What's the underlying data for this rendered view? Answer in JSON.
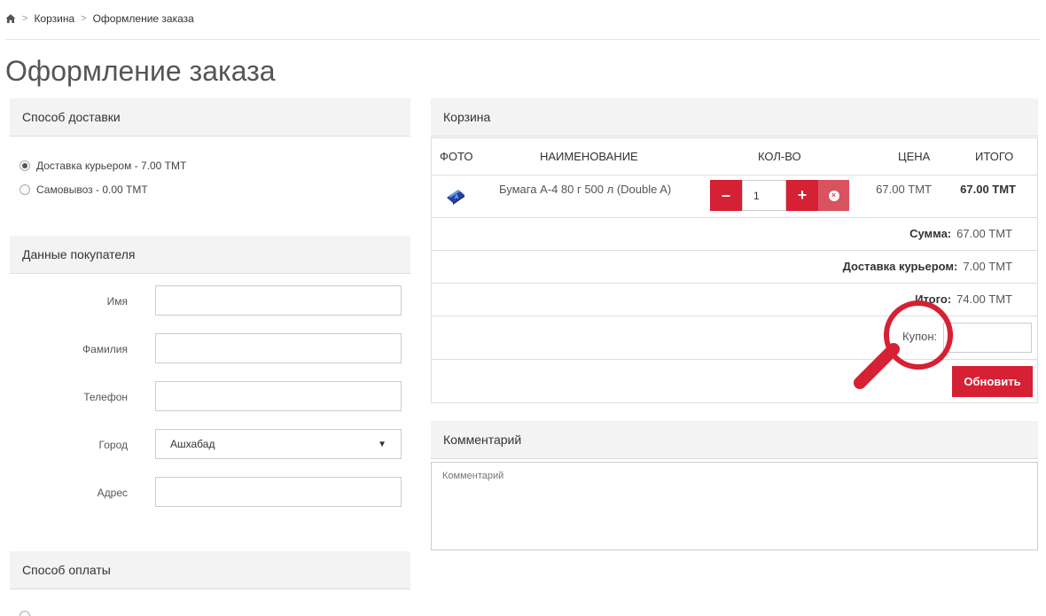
{
  "breadcrumb": {
    "items": [
      "Корзина",
      "Оформление заказа"
    ]
  },
  "page_title": "Оформление заказа",
  "delivery": {
    "heading": "Способ доставки",
    "options": [
      {
        "label": "Доставка курьером - 7.00 ТМТ",
        "checked": true
      },
      {
        "label": "Самовывоз - 0.00 ТМТ",
        "checked": false
      }
    ]
  },
  "buyer": {
    "heading": "Данные покупателя",
    "fields": {
      "first_name": {
        "label": "Имя",
        "value": ""
      },
      "last_name": {
        "label": "Фамилия",
        "value": ""
      },
      "phone": {
        "label": "Телефон",
        "value": ""
      },
      "city": {
        "label": "Город",
        "value": "Ашхабад"
      },
      "address": {
        "label": "Адрес",
        "value": ""
      }
    }
  },
  "payment": {
    "heading": "Способ оплаты"
  },
  "cart": {
    "heading": "Корзина",
    "columns": {
      "photo": "ФОТО",
      "name": "НАИМЕНОВАНИЕ",
      "qty": "КОЛ-ВО",
      "price": "ЦЕНА",
      "total": "ИТОГО"
    },
    "items": [
      {
        "name": "Бумага А-4 80 г 500 л (Double A)",
        "qty": "1",
        "price": "67.00 ТМТ",
        "total": "67.00 ТМТ"
      }
    ],
    "summary": {
      "sum_label": "Сумма:",
      "sum_value": "67.00 ТМТ",
      "delivery_label": "Доставка курьером:",
      "delivery_value": "7.00 ТМТ",
      "total_label": "Итого:",
      "total_value": "74.00 ТМТ"
    },
    "coupon_label": "Купон:",
    "coupon_value": "",
    "update_label": "Обновить"
  },
  "comment": {
    "heading": "Комментарий",
    "placeholder": "Комментарий"
  },
  "colors": {
    "accent": "#d62033",
    "remove": "#d9525f",
    "panel_bg": "#f3f3f3"
  },
  "icons": {
    "home": "home-icon",
    "minus": "minus-icon",
    "plus": "plus-icon",
    "remove": "remove-icon",
    "magnifier": "magnifier-icon"
  }
}
